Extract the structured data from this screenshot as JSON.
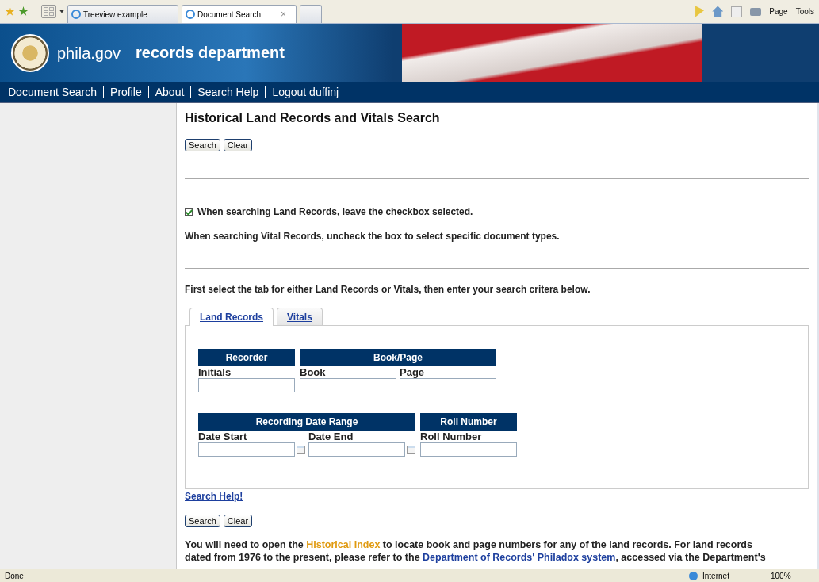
{
  "browser": {
    "tabs": [
      {
        "label": "Treeview example",
        "selected": false
      },
      {
        "label": "Document Search",
        "selected": true
      }
    ],
    "close_tab": "×",
    "menus": [
      {
        "label": "Page"
      },
      {
        "label": "Tools"
      }
    ]
  },
  "banner": {
    "site": "phila.gov",
    "department": "records department"
  },
  "nav": [
    {
      "label": "Document Search"
    },
    {
      "label": "Profile"
    },
    {
      "label": "About"
    },
    {
      "label": "Search Help"
    },
    {
      "label": "Logout duffinj"
    }
  ],
  "title": "Historical Land Records and Vitals Search",
  "top_buttons": [
    "Search",
    "Clear"
  ],
  "land_checkbox": {
    "label": "When searching Land Records, leave the checkbox selected.",
    "checked": true
  },
  "vitals_note": "When searching Vital Records, uncheck the box to select specific document types.",
  "instruction": "First select the tab for either Land Records or Vitals, then enter your search critera below.",
  "tabs": [
    {
      "label": "Land Records",
      "selected": true
    },
    {
      "label": "Vitals",
      "selected": false
    }
  ],
  "groups": [
    {
      "heading": "Recorder",
      "fields": [
        {
          "label": "Initials",
          "kind": "text"
        }
      ]
    },
    {
      "heading": "Book/Page",
      "fields": [
        {
          "label": "Book",
          "kind": "text"
        },
        {
          "label": "Page",
          "kind": "text"
        }
      ]
    },
    {
      "heading": "Recording Date Range",
      "fields": [
        {
          "label": "Date Start",
          "kind": "date"
        },
        {
          "label": "Date End",
          "kind": "date"
        }
      ]
    },
    {
      "heading": "Roll Number",
      "fields": [
        {
          "label": "Roll Number",
          "kind": "text"
        }
      ]
    }
  ],
  "help_link": "Search Help!",
  "bottom_buttons": [
    "Search",
    "Clear"
  ],
  "paragraph": [
    {
      "kind": "text",
      "text": "You will need to open the "
    },
    {
      "kind": "highlight-link",
      "text": "Historical Index"
    },
    {
      "kind": "text",
      "text": " to locate book and page numbers for any of the land records. For land records dated from 1976 to the present, please refer to the "
    },
    {
      "kind": "link",
      "text": "Department of Records' Philadox system"
    },
    {
      "kind": "text",
      "text": ", accessed via the Department's"
    }
  ],
  "status_bar": {
    "status": "Done",
    "zone": "Internet",
    "zoom": "100%"
  }
}
